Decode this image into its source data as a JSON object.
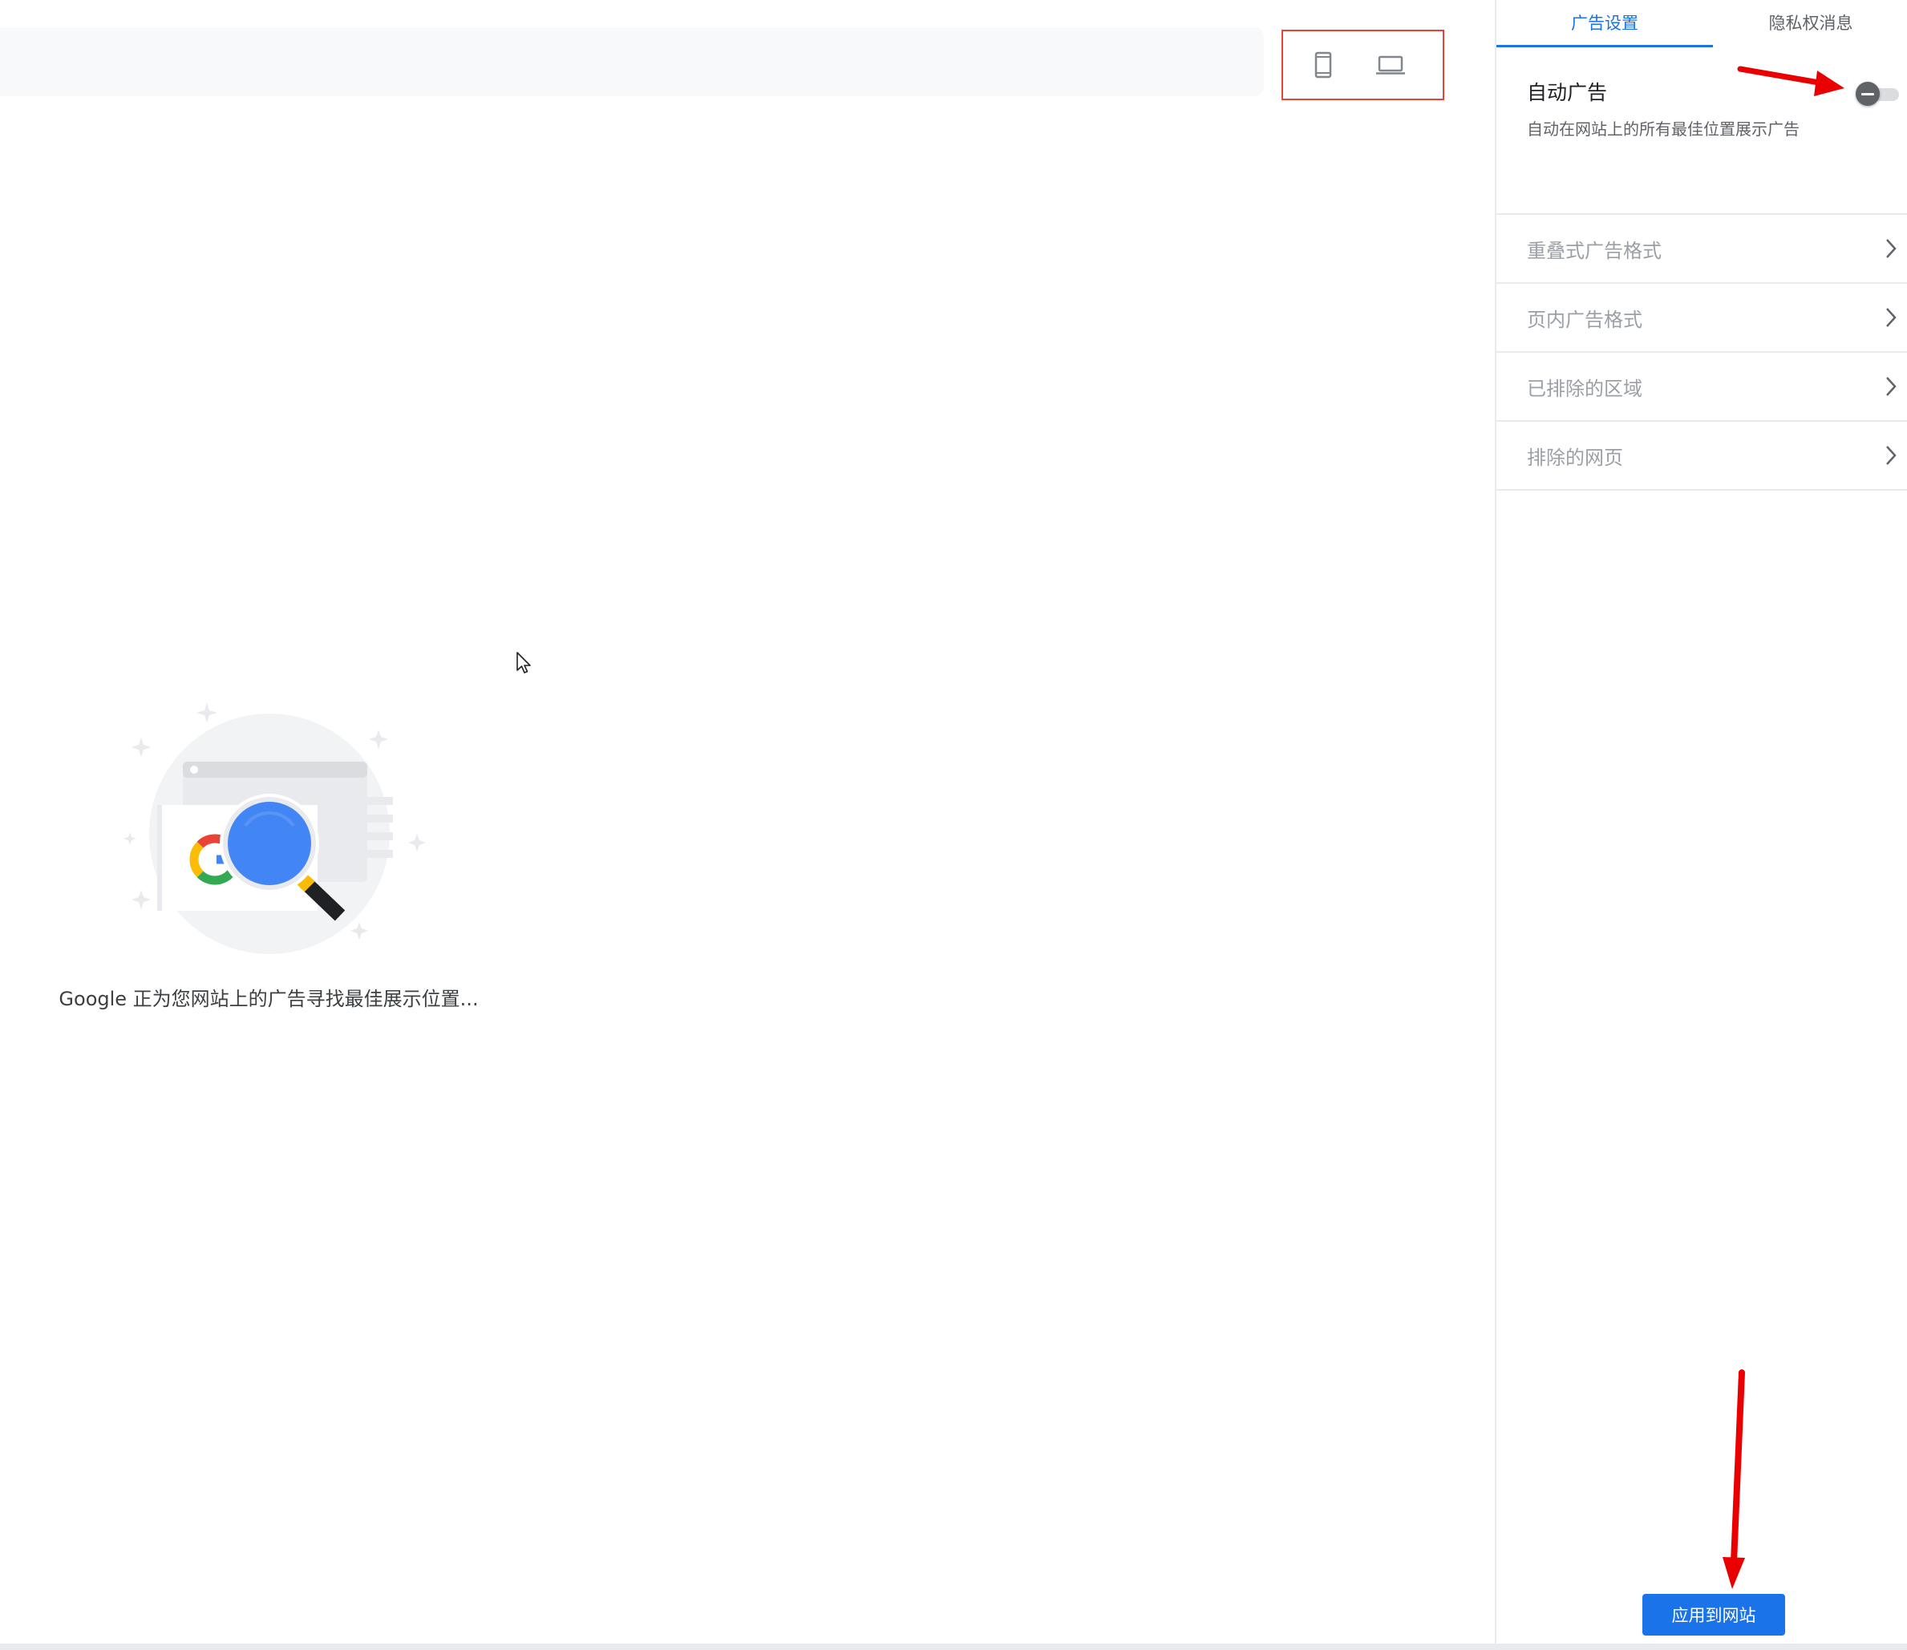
{
  "tabs": {
    "ad_settings": "广告设置",
    "privacy_messages": "隐私权消息"
  },
  "auto_ads": {
    "title": "自动广告",
    "description": "自动在网站上的所有最佳位置展示广告",
    "toggle_state": "off"
  },
  "menu": [
    {
      "label": "重叠式广告格式"
    },
    {
      "label": "页内广告格式"
    },
    {
      "label": "已排除的区域"
    },
    {
      "label": "排除的网页"
    }
  ],
  "apply_button": "应用到网站",
  "preview": {
    "loading_text": "Google 正为您网站上的广告寻找最佳展示位置..."
  },
  "colors": {
    "accent": "#1a73e8",
    "annotation": "#ea0000",
    "toggle_knob": "#5f6368",
    "divider": "#e8eaed"
  },
  "icons": {
    "phone": "phone-icon",
    "laptop": "laptop-icon",
    "chevron": "chevron-right-icon",
    "cursor": "mouse-cursor-icon"
  }
}
